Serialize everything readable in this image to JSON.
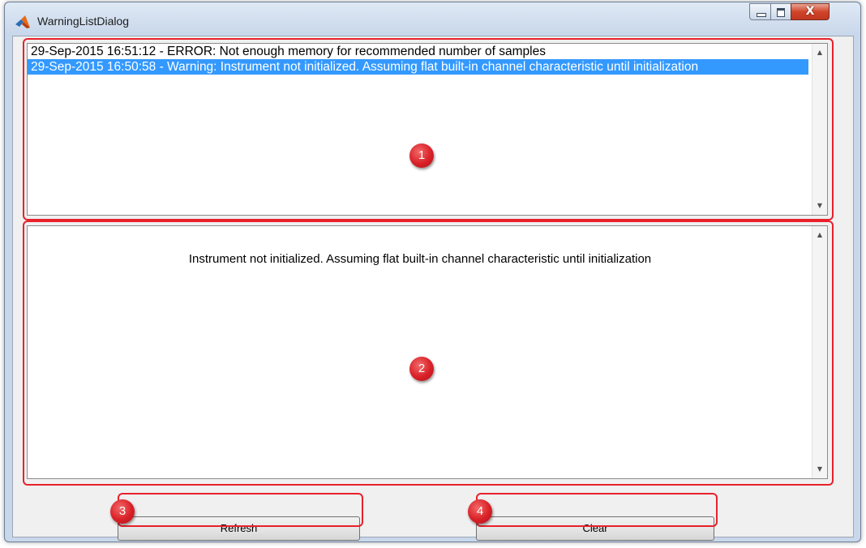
{
  "window": {
    "title": "WarningListDialog",
    "controls": {
      "minimize": "minimize",
      "maximize": "maximize",
      "close_glyph": "X"
    }
  },
  "warning_list": {
    "items": [
      {
        "text": "29-Sep-2015 16:51:12 - ERROR: Not enough memory for recommended number of samples",
        "selected": false
      },
      {
        "text": "29-Sep-2015 16:50:58 - Warning: Instrument not initialized. Assuming flat built-in channel characteristic until initialization",
        "selected": true
      }
    ]
  },
  "detail": {
    "text": "Instrument not initialized. Assuming flat built-in channel characteristic until initialization"
  },
  "buttons": {
    "refresh": "Refresh",
    "clear": "Clear"
  },
  "annotations": {
    "badges": [
      "1",
      "2",
      "3",
      "4"
    ],
    "color": "#e8212b"
  },
  "icons": {
    "app": "matlab-logo-icon",
    "scroll_up": "scroll-up-arrow-icon",
    "scroll_down": "scroll-down-arrow-icon"
  }
}
